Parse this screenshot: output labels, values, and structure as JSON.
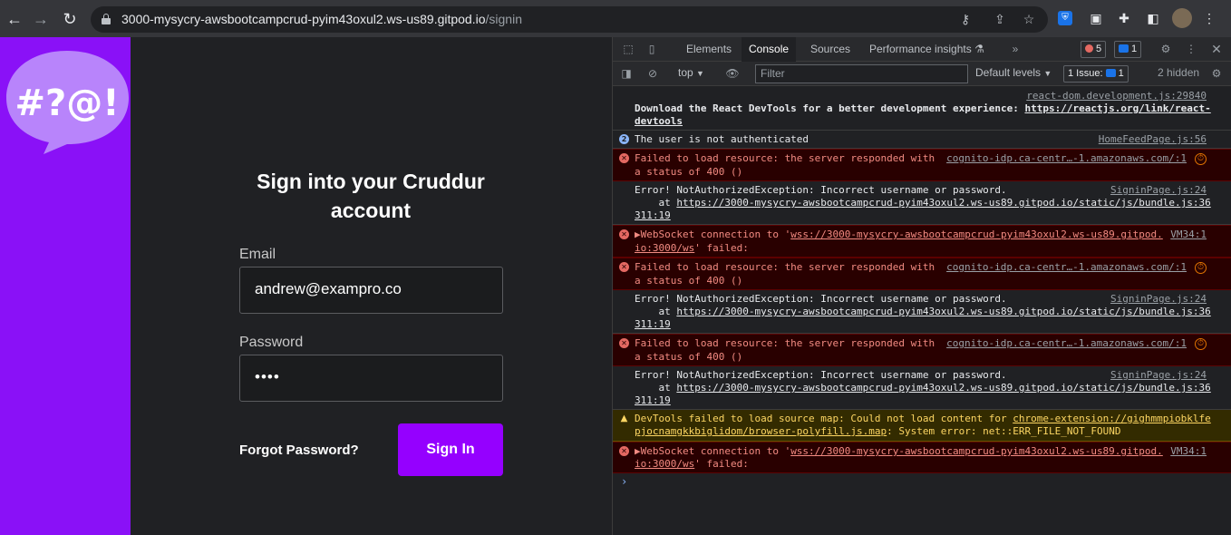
{
  "browser": {
    "url_host": "3000-mysycry-awsbootcampcrud-pyim43oxul2.ws-us89.gitpod.io",
    "url_path": "/signin"
  },
  "app": {
    "logo_text": "#?@!",
    "title": "Sign into your Cruddur account",
    "email_label": "Email",
    "email_value": "andrew@exampro.co",
    "password_label": "Password",
    "password_value": "••••",
    "forgot_label": "Forgot Password?",
    "signin_label": "Sign In",
    "colors": {
      "sidebar": "#8a11f7",
      "button": "#9500ff"
    }
  },
  "devtools": {
    "tabs": [
      "Elements",
      "Console",
      "Sources",
      "Performance insights"
    ],
    "active_tab": "Console",
    "error_count": "5",
    "message_count": "1",
    "context": "top",
    "filter_placeholder": "Filter",
    "levels": "Default levels",
    "issues": "1 Issue:",
    "issues_count": "1",
    "hidden": "2 hidden",
    "messages": [
      {
        "type": "log",
        "src": "react-dom.development.js:29840",
        "text1": "Download the React DevTools for a better development experience: ",
        "link": "https://reactjs.org/link/react-",
        "text2": "devtools"
      },
      {
        "type": "info",
        "count": "2",
        "text": "The user is not authenticated",
        "src": "HomeFeedPage.js:56"
      },
      {
        "type": "error",
        "text1": "Failed to load resource: the server responded with",
        "text2": "a status of 400 ()",
        "src": "cognito-idp.ca-centr…-1.amazonaws.com/:1"
      },
      {
        "type": "log",
        "text1": "Error! NotAuthorizedException: Incorrect username or password.",
        "at": "    at ",
        "link": "https://3000-mysycry-awsbootcampcrud-pyim43oxul2.ws-us89.gitpod.io/static/js/bundle.js:36",
        "text2": "311:19",
        "src": "SigninPage.js:24"
      },
      {
        "type": "error",
        "pre": "▶WebSocket connection to '",
        "link": "wss://3000-mysycry-awsbootcampcrud-pyim43oxul2.ws-us89.gitpod.",
        "link2": "io:3000/ws",
        "post": "' failed:",
        "src": "VM34:1"
      },
      {
        "type": "error",
        "text1": "Failed to load resource: the server responded with",
        "text2": "a status of 400 ()",
        "src": "cognito-idp.ca-centr…-1.amazonaws.com/:1"
      },
      {
        "type": "log",
        "text1": "Error! NotAuthorizedException: Incorrect username or password.",
        "at": "    at ",
        "link": "https://3000-mysycry-awsbootcampcrud-pyim43oxul2.ws-us89.gitpod.io/static/js/bundle.js:36",
        "text2": "311:19",
        "src": "SigninPage.js:24"
      },
      {
        "type": "error",
        "text1": "Failed to load resource: the server responded with",
        "text2": "a status of 400 ()",
        "src": "cognito-idp.ca-centr…-1.amazonaws.com/:1"
      },
      {
        "type": "log",
        "text1": "Error! NotAuthorizedException: Incorrect username or password.",
        "at": "    at ",
        "link": "https://3000-mysycry-awsbootcampcrud-pyim43oxul2.ws-us89.gitpod.io/static/js/bundle.js:36",
        "text2": "311:19",
        "src": "SigninPage.js:24"
      },
      {
        "type": "warning",
        "pre": "DevTools failed to load source map: Could not load content for ",
        "link": "chrome-extension://gighmmpiobklfe",
        "link2": "pjocnamgkkbiglidom/browser-polyfill.js.map",
        "post": ": System error: net::ERR_FILE_NOT_FOUND"
      },
      {
        "type": "error",
        "pre": "▶WebSocket connection to '",
        "link": "wss://3000-mysycry-awsbootcampcrud-pyim43oxul2.ws-us89.gitpod.",
        "link2": "io:3000/ws",
        "post": "' failed:",
        "src": "VM34:1"
      }
    ],
    "prompt": "›"
  }
}
